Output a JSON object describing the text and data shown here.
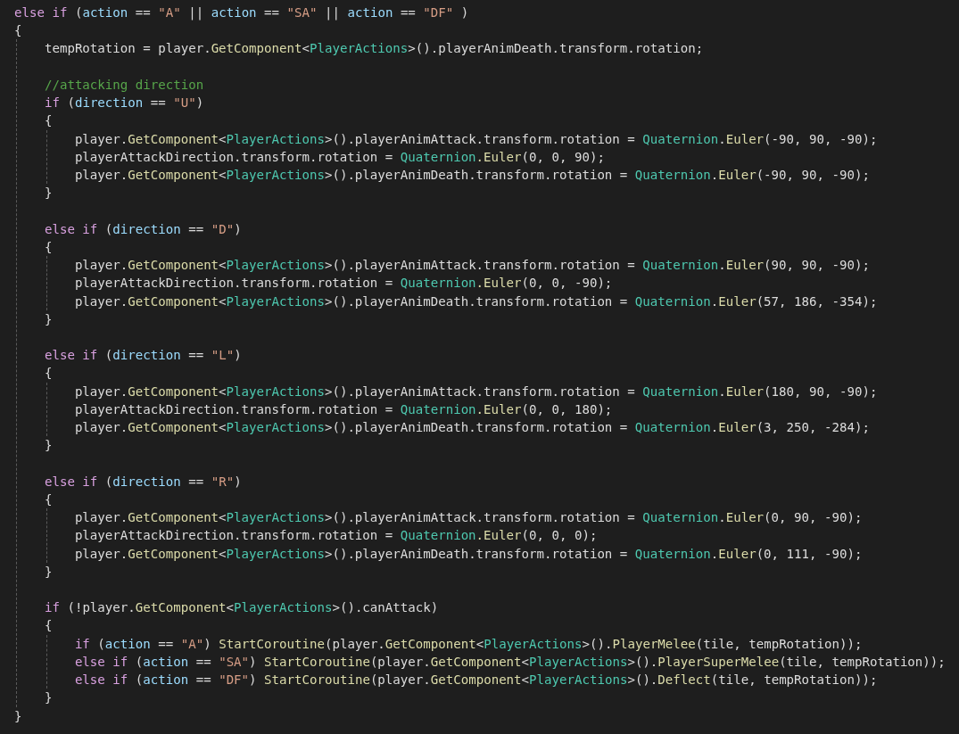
{
  "code": [
    {
      "kind": "line",
      "tokens": [
        {
          "kind": "keyword",
          "text": "else if"
        },
        {
          "kind": "plain",
          "text": " ("
        },
        {
          "kind": "variable",
          "text": "action"
        },
        {
          "kind": "plain",
          "text": " == "
        },
        {
          "kind": "string",
          "text": "\"A\""
        },
        {
          "kind": "plain",
          "text": " || "
        },
        {
          "kind": "variable",
          "text": "action"
        },
        {
          "kind": "plain",
          "text": " == "
        },
        {
          "kind": "string",
          "text": "\"SA\""
        },
        {
          "kind": "plain",
          "text": " || "
        },
        {
          "kind": "variable",
          "text": "action"
        },
        {
          "kind": "plain",
          "text": " == "
        },
        {
          "kind": "string",
          "text": "\"DF\""
        },
        {
          "kind": "plain",
          "text": " )"
        }
      ]
    },
    {
      "kind": "line",
      "tokens": [
        {
          "kind": "plain",
          "text": "{"
        }
      ]
    },
    {
      "kind": "block",
      "children": [
        {
          "kind": "line",
          "tokens": [
            {
              "kind": "plain",
              "text": "tempRotation = player."
            },
            {
              "kind": "method",
              "text": "GetComponent"
            },
            {
              "kind": "plain",
              "text": "<"
            },
            {
              "kind": "type",
              "text": "PlayerActions"
            },
            {
              "kind": "plain",
              "text": ">().playerAnimDeath.transform.rotation;"
            }
          ]
        },
        {
          "kind": "blank"
        },
        {
          "kind": "line",
          "tokens": [
            {
              "kind": "comment",
              "text": "//attacking direction"
            }
          ]
        },
        {
          "kind": "line",
          "tokens": [
            {
              "kind": "keyword",
              "text": "if"
            },
            {
              "kind": "plain",
              "text": " ("
            },
            {
              "kind": "variable",
              "text": "direction"
            },
            {
              "kind": "plain",
              "text": " == "
            },
            {
              "kind": "string",
              "text": "\"U\""
            },
            {
              "kind": "plain",
              "text": ")"
            }
          ]
        },
        {
          "kind": "line",
          "tokens": [
            {
              "kind": "plain",
              "text": "{"
            }
          ]
        },
        {
          "kind": "block",
          "children": [
            {
              "kind": "line",
              "tokens": [
                {
                  "kind": "plain",
                  "text": "player."
                },
                {
                  "kind": "method",
                  "text": "GetComponent"
                },
                {
                  "kind": "plain",
                  "text": "<"
                },
                {
                  "kind": "type",
                  "text": "PlayerActions"
                },
                {
                  "kind": "plain",
                  "text": ">().playerAnimAttack.transform.rotation = "
                },
                {
                  "kind": "type",
                  "text": "Quaternion"
                },
                {
                  "kind": "plain",
                  "text": "."
                },
                {
                  "kind": "method",
                  "text": "Euler"
                },
                {
                  "kind": "plain",
                  "text": "(-90, 90, -90);"
                }
              ]
            },
            {
              "kind": "line",
              "tokens": [
                {
                  "kind": "plain",
                  "text": "playerAttackDirection.transform.rotation = "
                },
                {
                  "kind": "type",
                  "text": "Quaternion"
                },
                {
                  "kind": "method",
                  "text": ".Euler"
                },
                {
                  "kind": "plain",
                  "text": "(0, 0, 90);"
                }
              ]
            },
            {
              "kind": "line",
              "tokens": [
                {
                  "kind": "plain",
                  "text": "player."
                },
                {
                  "kind": "method",
                  "text": "GetComponent"
                },
                {
                  "kind": "plain",
                  "text": "<"
                },
                {
                  "kind": "type",
                  "text": "PlayerActions"
                },
                {
                  "kind": "plain",
                  "text": ">().playerAnimDeath.transform.rotation = "
                },
                {
                  "kind": "type",
                  "text": "Quaternion"
                },
                {
                  "kind": "plain",
                  "text": "."
                },
                {
                  "kind": "method",
                  "text": "Euler"
                },
                {
                  "kind": "plain",
                  "text": "(-90, 90, -90);"
                }
              ]
            }
          ]
        },
        {
          "kind": "line",
          "tokens": [
            {
              "kind": "plain",
              "text": "}"
            }
          ]
        },
        {
          "kind": "blank"
        },
        {
          "kind": "line",
          "tokens": [
            {
              "kind": "keyword",
              "text": "else if"
            },
            {
              "kind": "plain",
              "text": " ("
            },
            {
              "kind": "variable",
              "text": "direction"
            },
            {
              "kind": "plain",
              "text": " == "
            },
            {
              "kind": "string",
              "text": "\"D\""
            },
            {
              "kind": "plain",
              "text": ")"
            }
          ]
        },
        {
          "kind": "line",
          "tokens": [
            {
              "kind": "plain",
              "text": "{"
            }
          ]
        },
        {
          "kind": "block",
          "children": [
            {
              "kind": "line",
              "tokens": [
                {
                  "kind": "plain",
                  "text": "player."
                },
                {
                  "kind": "method",
                  "text": "GetComponent"
                },
                {
                  "kind": "plain",
                  "text": "<"
                },
                {
                  "kind": "type",
                  "text": "PlayerActions"
                },
                {
                  "kind": "plain",
                  "text": ">().playerAnimAttack.transform.rotation = "
                },
                {
                  "kind": "type",
                  "text": "Quaternion"
                },
                {
                  "kind": "plain",
                  "text": "."
                },
                {
                  "kind": "method",
                  "text": "Euler"
                },
                {
                  "kind": "plain",
                  "text": "(90, 90, -90);"
                }
              ]
            },
            {
              "kind": "line",
              "tokens": [
                {
                  "kind": "plain",
                  "text": "playerAttackDirection.transform.rotation = "
                },
                {
                  "kind": "type",
                  "text": "Quaternion"
                },
                {
                  "kind": "method",
                  "text": ".Euler"
                },
                {
                  "kind": "plain",
                  "text": "(0, 0, -90);"
                }
              ]
            },
            {
              "kind": "line",
              "tokens": [
                {
                  "kind": "plain",
                  "text": "player."
                },
                {
                  "kind": "method",
                  "text": "GetComponent"
                },
                {
                  "kind": "plain",
                  "text": "<"
                },
                {
                  "kind": "type",
                  "text": "PlayerActions"
                },
                {
                  "kind": "plain",
                  "text": ">().playerAnimDeath.transform.rotation = "
                },
                {
                  "kind": "type",
                  "text": "Quaternion"
                },
                {
                  "kind": "plain",
                  "text": "."
                },
                {
                  "kind": "method",
                  "text": "Euler"
                },
                {
                  "kind": "plain",
                  "text": "(57, 186, -354);"
                }
              ]
            }
          ]
        },
        {
          "kind": "line",
          "tokens": [
            {
              "kind": "plain",
              "text": "}"
            }
          ]
        },
        {
          "kind": "blank"
        },
        {
          "kind": "line",
          "tokens": [
            {
              "kind": "keyword",
              "text": "else if"
            },
            {
              "kind": "plain",
              "text": " ("
            },
            {
              "kind": "variable",
              "text": "direction"
            },
            {
              "kind": "plain",
              "text": " == "
            },
            {
              "kind": "string",
              "text": "\"L\""
            },
            {
              "kind": "plain",
              "text": ")"
            }
          ]
        },
        {
          "kind": "line",
          "tokens": [
            {
              "kind": "plain",
              "text": "{"
            }
          ]
        },
        {
          "kind": "block",
          "children": [
            {
              "kind": "line",
              "tokens": [
                {
                  "kind": "plain",
                  "text": "player."
                },
                {
                  "kind": "method",
                  "text": "GetComponent"
                },
                {
                  "kind": "plain",
                  "text": "<"
                },
                {
                  "kind": "type",
                  "text": "PlayerActions"
                },
                {
                  "kind": "plain",
                  "text": ">().playerAnimAttack.transform.rotation = "
                },
                {
                  "kind": "type",
                  "text": "Quaternion"
                },
                {
                  "kind": "plain",
                  "text": "."
                },
                {
                  "kind": "method",
                  "text": "Euler"
                },
                {
                  "kind": "plain",
                  "text": "(180, 90, -90);"
                }
              ]
            },
            {
              "kind": "line",
              "tokens": [
                {
                  "kind": "plain",
                  "text": "playerAttackDirection.transform.rotation = "
                },
                {
                  "kind": "type",
                  "text": "Quaternion"
                },
                {
                  "kind": "method",
                  "text": ".Euler"
                },
                {
                  "kind": "plain",
                  "text": "(0, 0, 180);"
                }
              ]
            },
            {
              "kind": "line",
              "tokens": [
                {
                  "kind": "plain",
                  "text": "player."
                },
                {
                  "kind": "method",
                  "text": "GetComponent"
                },
                {
                  "kind": "plain",
                  "text": "<"
                },
                {
                  "kind": "type",
                  "text": "PlayerActions"
                },
                {
                  "kind": "plain",
                  "text": ">().playerAnimDeath.transform.rotation = "
                },
                {
                  "kind": "type",
                  "text": "Quaternion"
                },
                {
                  "kind": "plain",
                  "text": "."
                },
                {
                  "kind": "method",
                  "text": "Euler"
                },
                {
                  "kind": "plain",
                  "text": "(3, 250, -284);"
                }
              ]
            }
          ]
        },
        {
          "kind": "line",
          "tokens": [
            {
              "kind": "plain",
              "text": "}"
            }
          ]
        },
        {
          "kind": "blank"
        },
        {
          "kind": "line",
          "tokens": [
            {
              "kind": "keyword",
              "text": "else if"
            },
            {
              "kind": "plain",
              "text": " ("
            },
            {
              "kind": "variable",
              "text": "direction"
            },
            {
              "kind": "plain",
              "text": " == "
            },
            {
              "kind": "string",
              "text": "\"R\""
            },
            {
              "kind": "plain",
              "text": ")"
            }
          ]
        },
        {
          "kind": "line",
          "tokens": [
            {
              "kind": "plain",
              "text": "{"
            }
          ]
        },
        {
          "kind": "block",
          "children": [
            {
              "kind": "line",
              "tokens": [
                {
                  "kind": "plain",
                  "text": "player."
                },
                {
                  "kind": "method",
                  "text": "GetComponent"
                },
                {
                  "kind": "plain",
                  "text": "<"
                },
                {
                  "kind": "type",
                  "text": "PlayerActions"
                },
                {
                  "kind": "plain",
                  "text": ">().playerAnimAttack.transform.rotation = "
                },
                {
                  "kind": "type",
                  "text": "Quaternion"
                },
                {
                  "kind": "plain",
                  "text": "."
                },
                {
                  "kind": "method",
                  "text": "Euler"
                },
                {
                  "kind": "plain",
                  "text": "(0, 90, -90);"
                }
              ]
            },
            {
              "kind": "line",
              "tokens": [
                {
                  "kind": "plain",
                  "text": "playerAttackDirection.transform.rotation = "
                },
                {
                  "kind": "type",
                  "text": "Quaternion"
                },
                {
                  "kind": "method",
                  "text": ".Euler"
                },
                {
                  "kind": "plain",
                  "text": "(0, 0, 0);"
                }
              ]
            },
            {
              "kind": "line",
              "tokens": [
                {
                  "kind": "plain",
                  "text": "player."
                },
                {
                  "kind": "method",
                  "text": "GetComponent"
                },
                {
                  "kind": "plain",
                  "text": "<"
                },
                {
                  "kind": "type",
                  "text": "PlayerActions"
                },
                {
                  "kind": "plain",
                  "text": ">().playerAnimDeath.transform.rotation = "
                },
                {
                  "kind": "type",
                  "text": "Quaternion"
                },
                {
                  "kind": "plain",
                  "text": "."
                },
                {
                  "kind": "method",
                  "text": "Euler"
                },
                {
                  "kind": "plain",
                  "text": "(0, 111, -90);"
                }
              ]
            }
          ]
        },
        {
          "kind": "line",
          "tokens": [
            {
              "kind": "plain",
              "text": "}"
            }
          ]
        },
        {
          "kind": "blank"
        },
        {
          "kind": "line",
          "tokens": [
            {
              "kind": "keyword",
              "text": "if"
            },
            {
              "kind": "plain",
              "text": " (!player."
            },
            {
              "kind": "method",
              "text": "GetComponent"
            },
            {
              "kind": "plain",
              "text": "<"
            },
            {
              "kind": "type",
              "text": "PlayerActions"
            },
            {
              "kind": "plain",
              "text": ">().canAttack)"
            }
          ]
        },
        {
          "kind": "line",
          "tokens": [
            {
              "kind": "plain",
              "text": "{"
            }
          ]
        },
        {
          "kind": "block",
          "children": [
            {
              "kind": "line",
              "tokens": [
                {
                  "kind": "keyword",
                  "text": "if"
                },
                {
                  "kind": "plain",
                  "text": " ("
                },
                {
                  "kind": "variable",
                  "text": "action"
                },
                {
                  "kind": "plain",
                  "text": " == "
                },
                {
                  "kind": "string",
                  "text": "\"A\""
                },
                {
                  "kind": "plain",
                  "text": ") "
                },
                {
                  "kind": "method",
                  "text": "StartCoroutine"
                },
                {
                  "kind": "plain",
                  "text": "(player."
                },
                {
                  "kind": "method",
                  "text": "GetComponent"
                },
                {
                  "kind": "plain",
                  "text": "<"
                },
                {
                  "kind": "type",
                  "text": "PlayerActions"
                },
                {
                  "kind": "plain",
                  "text": ">()."
                },
                {
                  "kind": "method",
                  "text": "PlayerMelee"
                },
                {
                  "kind": "plain",
                  "text": "(tile, tempRotation));"
                }
              ]
            },
            {
              "kind": "line",
              "tokens": [
                {
                  "kind": "keyword",
                  "text": "else if"
                },
                {
                  "kind": "plain",
                  "text": " ("
                },
                {
                  "kind": "variable",
                  "text": "action"
                },
                {
                  "kind": "plain",
                  "text": " == "
                },
                {
                  "kind": "string",
                  "text": "\"SA\""
                },
                {
                  "kind": "plain",
                  "text": ") "
                },
                {
                  "kind": "method",
                  "text": "StartCoroutine"
                },
                {
                  "kind": "plain",
                  "text": "(player."
                },
                {
                  "kind": "method",
                  "text": "GetComponent"
                },
                {
                  "kind": "plain",
                  "text": "<"
                },
                {
                  "kind": "type",
                  "text": "PlayerActions"
                },
                {
                  "kind": "plain",
                  "text": ">()."
                },
                {
                  "kind": "method",
                  "text": "PlayerSuperMelee"
                },
                {
                  "kind": "plain",
                  "text": "(tile, tempRotation));"
                }
              ]
            },
            {
              "kind": "line",
              "tokens": [
                {
                  "kind": "keyword",
                  "text": "else if"
                },
                {
                  "kind": "plain",
                  "text": " ("
                },
                {
                  "kind": "variable",
                  "text": "action"
                },
                {
                  "kind": "plain",
                  "text": " == "
                },
                {
                  "kind": "string",
                  "text": "\"DF\""
                },
                {
                  "kind": "plain",
                  "text": ") "
                },
                {
                  "kind": "method",
                  "text": "StartCoroutine"
                },
                {
                  "kind": "plain",
                  "text": "(player."
                },
                {
                  "kind": "method",
                  "text": "GetComponent"
                },
                {
                  "kind": "plain",
                  "text": "<"
                },
                {
                  "kind": "type",
                  "text": "PlayerActions"
                },
                {
                  "kind": "plain",
                  "text": ">()."
                },
                {
                  "kind": "method",
                  "text": "Deflect"
                },
                {
                  "kind": "plain",
                  "text": "(tile, tempRotation));"
                }
              ]
            }
          ]
        },
        {
          "kind": "line",
          "tokens": [
            {
              "kind": "plain",
              "text": "}"
            }
          ]
        }
      ]
    },
    {
      "kind": "line",
      "tokens": [
        {
          "kind": "plain",
          "text": "}"
        }
      ]
    }
  ]
}
